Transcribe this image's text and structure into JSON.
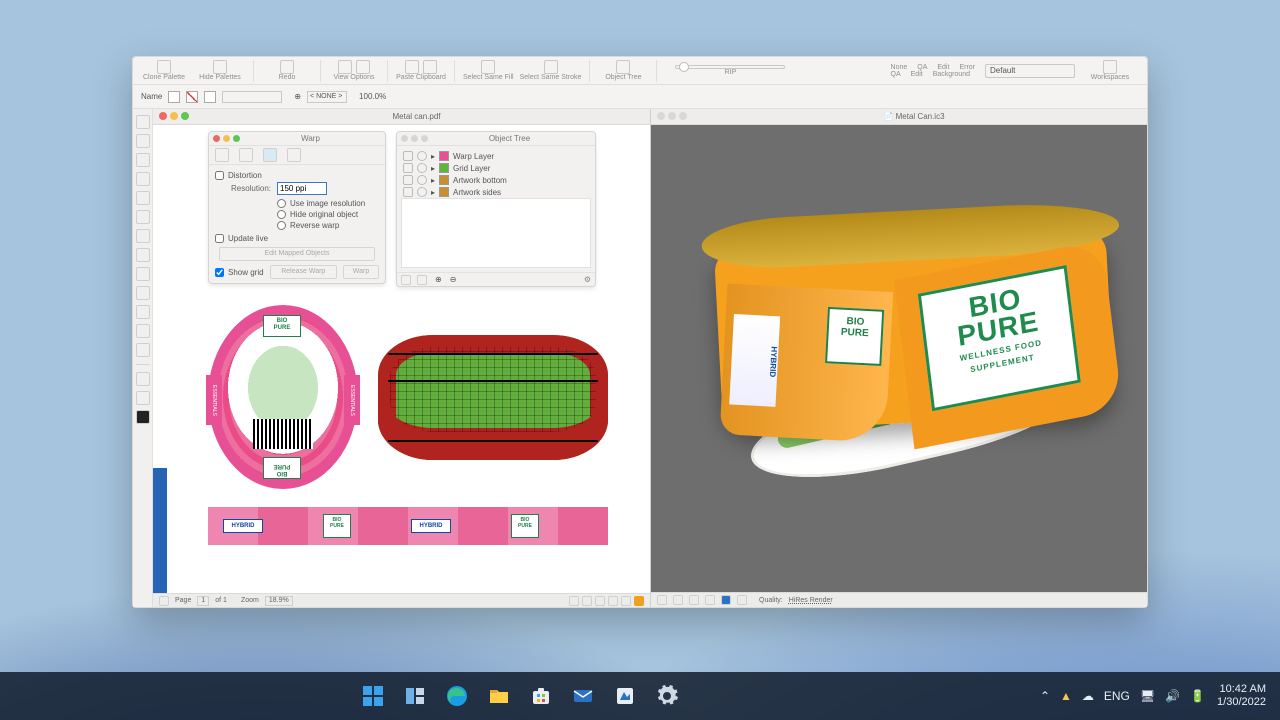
{
  "app": {
    "toolbar": {
      "groups": [
        {
          "label": "Clone Palette",
          "icons": 1
        },
        {
          "label": "Hide Palettes",
          "icons": 1
        },
        {
          "label": "Redo",
          "icons": 1
        },
        {
          "label": "View Options",
          "icons": 2
        },
        {
          "label": "Paste Clipboard",
          "icons": 2
        },
        {
          "label": "Select Same Fill",
          "icons": 1
        },
        {
          "label": "Select Same Stroke",
          "icons": 1
        },
        {
          "label": "Object Tree",
          "icons": 1
        }
      ],
      "slider_label": "RIP",
      "right": {
        "row1": [
          "None",
          "QA",
          "Edit",
          "Error"
        ],
        "row2": [
          "QA",
          "Edit",
          "Background",
          ""
        ],
        "preset": "Default",
        "workspaces": "Workspaces"
      }
    },
    "subbar": {
      "name_label": "Name",
      "none_label": "< NONE >",
      "pct": "100.0%"
    },
    "left_tool_count": 17
  },
  "docs": {
    "left_tab": "Metal can.pdf",
    "right_tab": "Metal Can.ic3",
    "status": {
      "page_label": "Page",
      "page_current": "1",
      "page_total": "of 1",
      "zoom_label": "Zoom",
      "zoom_value": "18.9%"
    },
    "right_status": {
      "quality_label": "Quality:",
      "quality_value": "HiRes Render"
    }
  },
  "panels": {
    "warp": {
      "title": "Warp",
      "section_distortion": "Distortion",
      "resolution_label": "Resolution:",
      "resolution_value": "150 ppi",
      "opt_use_image": "Use image resolution",
      "opt_hide_original": "Hide original object",
      "opt_reverse": "Reverse warp",
      "update_live": "Update live",
      "btn_edit": "Edit Mapped Objects",
      "show_grid": "Show grid",
      "btn_release": "Release Warp",
      "btn_warp": "Warp"
    },
    "object_tree": {
      "title": "Object Tree",
      "layers": [
        {
          "name": "Warp Layer",
          "color": "#e85096"
        },
        {
          "name": "Grid Layer",
          "color": "#5fb53a"
        },
        {
          "name": "Artwork bottom",
          "color": "#c98f2e"
        },
        {
          "name": "Artwork sides",
          "color": "#c98f2e"
        }
      ]
    }
  },
  "artwork": {
    "brand_line1": "BIO",
    "brand_line2": "PURE",
    "tagline1": "WELLNESS FOOD",
    "tagline2": "SUPPLEMENT",
    "side_text": "ESSENTIALS",
    "hybrid": "HYBRID"
  },
  "taskbar": {
    "lang": "ENG",
    "time": "10:42 AM",
    "date": "1/30/2022"
  }
}
